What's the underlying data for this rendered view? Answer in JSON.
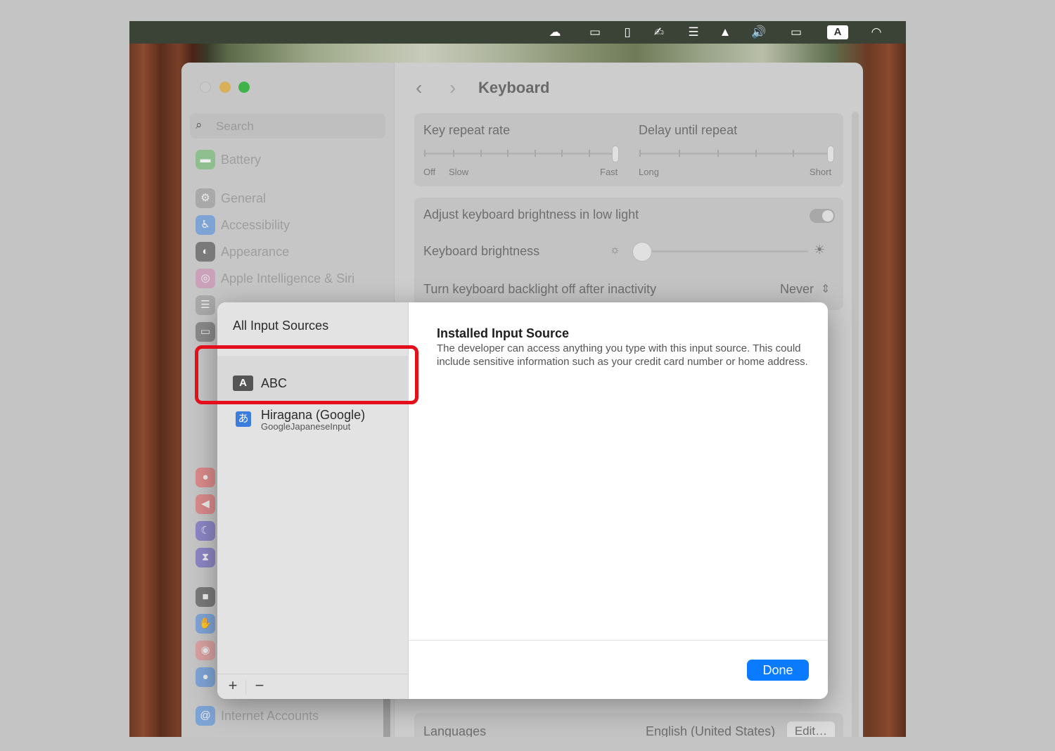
{
  "menubar": {
    "icons": [
      "cloud-icon",
      "window-icon",
      "document-icon",
      "signature-icon",
      "clipboard-icon",
      "drive-icon",
      "volume-icon",
      "battery-icon",
      "wifi-icon"
    ],
    "input_indicator": "A"
  },
  "settings": {
    "search_placeholder": "Search",
    "sidebar_items": [
      {
        "label": "Battery",
        "icon": "battery-icon"
      },
      {
        "label": "General",
        "icon": "gear-icon"
      },
      {
        "label": "Accessibility",
        "icon": "accessibility-icon"
      },
      {
        "label": "Appearance",
        "icon": "appearance-icon"
      },
      {
        "label": "Apple Intelligence & Siri",
        "icon": "siri-icon"
      }
    ],
    "bottom_item": "Internet Accounts",
    "pane_title": "Keyboard",
    "key_repeat": {
      "label": "Key repeat rate",
      "min1": "Off",
      "min2": "Slow",
      "max": "Fast"
    },
    "delay_repeat": {
      "label": "Delay until repeat",
      "min": "Long",
      "max": "Short"
    },
    "adjust_brightness": "Adjust keyboard brightness in low light",
    "keyboard_brightness": "Keyboard brightness",
    "backlight_off": {
      "label": "Turn keyboard backlight off after inactivity",
      "value": "Never"
    },
    "languages": {
      "label": "Languages",
      "value": "English (United States)",
      "button": "Edit…"
    }
  },
  "sheet": {
    "left_title": "All Input Sources",
    "sources": [
      {
        "icon_text": "A",
        "label": "ABC",
        "sub": ""
      },
      {
        "icon_text": "あ",
        "label": "Hiragana (Google)",
        "sub": "GoogleJapaneseInput"
      }
    ],
    "add": "+",
    "remove": "−",
    "detail_title": "Installed Input Source",
    "detail_body": "The developer can access anything you type with this input source. This could include sensitive information such as your credit card number or home address.",
    "done": "Done"
  }
}
